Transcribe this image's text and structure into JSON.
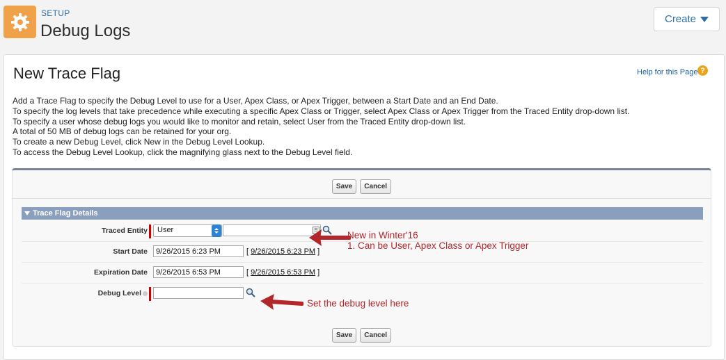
{
  "header": {
    "setup_label": "SETUP",
    "title": "Debug Logs",
    "create_label": "Create",
    "icon": "gear-icon",
    "accent_color": "#f0a24a"
  },
  "panel": {
    "title": "New Trace Flag",
    "help_label": "Help for this Page",
    "description": [
      "Add a Trace Flag to specify the Debug Level to use for a User, Apex Class, or Apex Trigger, between a Start Date and an End Date.",
      "To specify the log levels that take precedence while executing a specific Apex Class or Trigger, select Apex Class or Apex Trigger from the Traced Entity drop-down list.",
      "To specify a user whose debug logs you would like to monitor and retain, select User from the Traced Entity drop-down list.",
      "A total of 50 MB of debug logs can be retained for your org.",
      "To create a new Debug Level, click New in the Debug Level Lookup.",
      "To access the Debug Level Lookup, click the magnifying glass next to the Debug Level field."
    ]
  },
  "form": {
    "save_label": "Save",
    "cancel_label": "Cancel",
    "section_title": "Trace Flag Details",
    "traced_entity": {
      "label": "Traced Entity",
      "selected": "User",
      "value": ""
    },
    "start_date": {
      "label": "Start Date",
      "value": "9/26/2015 6:23 PM",
      "link": "9/26/2015 6:23 PM"
    },
    "expiration_date": {
      "label": "Expiration Date",
      "value": "9/26/2015 6:53 PM",
      "link": "9/26/2015 6:53 PM"
    },
    "debug_level": {
      "label": "Debug Level",
      "value": ""
    }
  },
  "annotations": {
    "traced_entity_line1": "New in Winter'16",
    "traced_entity_line2": "1.  Can be User, Apex Class or Apex Trigger",
    "debug_level": "Set the debug level here",
    "color": "#b3262a"
  },
  "bracket_open": "[",
  "bracket_close": "]"
}
